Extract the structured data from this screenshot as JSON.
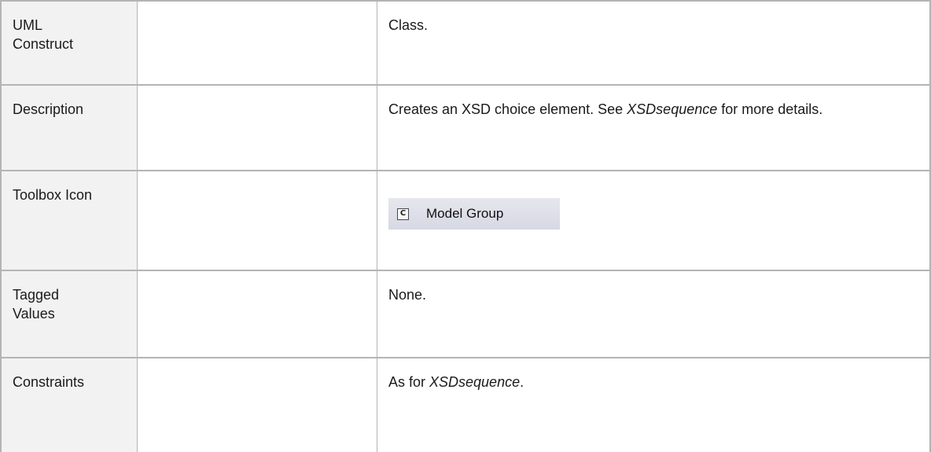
{
  "rows": [
    {
      "label": "UML\nConstruct",
      "label_l1": "UML",
      "label_l2": "Construct",
      "value": "Class."
    },
    {
      "label": "Description",
      "value_pre": "Creates an XSD choice element. See ",
      "value_em": "XSDsequence",
      "value_post": " for more details."
    },
    {
      "label": "Toolbox Icon",
      "icon": {
        "glyph": "C",
        "name": "class-icon",
        "text": "Model Group"
      }
    },
    {
      "label_l1": "Tagged",
      "label_l2": "Values",
      "value": "None."
    },
    {
      "label": "Constraints",
      "value_pre": "As for ",
      "value_em": "XSDsequence",
      "value_post": "."
    }
  ]
}
